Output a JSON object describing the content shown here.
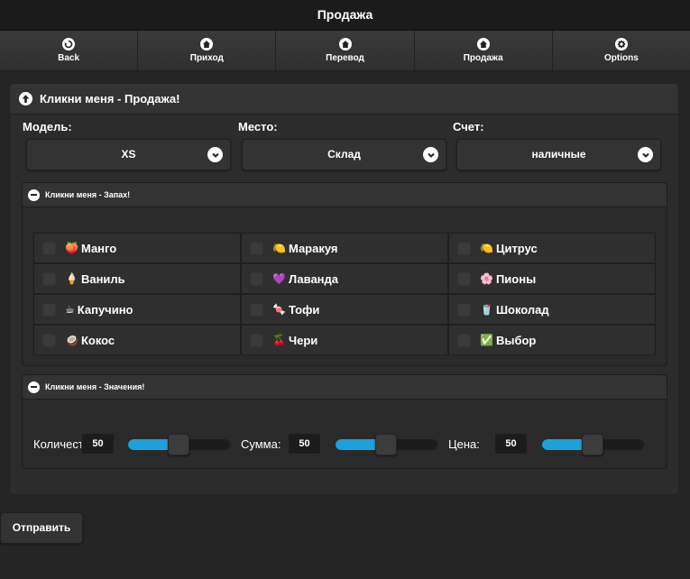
{
  "header": {
    "title": "Продажа"
  },
  "nav": [
    {
      "label": "Back",
      "icon": "back-arrow-icon"
    },
    {
      "label": "Приход",
      "icon": "home-icon"
    },
    {
      "label": "Перевод",
      "icon": "home-icon"
    },
    {
      "label": "Продажа",
      "icon": "home-icon"
    },
    {
      "label": "Options",
      "icon": "gear-icon"
    }
  ],
  "panel": {
    "title": "Кликни меня - Продажа!"
  },
  "selects": [
    {
      "label": "Модель:",
      "value": "XS"
    },
    {
      "label": "Место:",
      "value": "Склад"
    },
    {
      "label": "Счет:",
      "value": "наличные"
    }
  ],
  "scents": {
    "title": "Кликни меня - Запах!",
    "items": [
      {
        "emoji": "🍑",
        "label": "Манго"
      },
      {
        "emoji": "🍋",
        "label": "Маракуя"
      },
      {
        "emoji": "🍋",
        "label": "Цитрус"
      },
      {
        "emoji": "🍦",
        "label": "Ваниль"
      },
      {
        "emoji": "💜",
        "label": "Лаванда"
      },
      {
        "emoji": "🌸",
        "label": "Пионы"
      },
      {
        "emoji": "☕",
        "label": "Капучино"
      },
      {
        "emoji": "🍬",
        "label": "Тофи"
      },
      {
        "emoji": "🥤",
        "label": "Шоколад"
      },
      {
        "emoji": "🥥",
        "label": "Кокос"
      },
      {
        "emoji": "🍒",
        "label": "Чери"
      },
      {
        "emoji": "✅",
        "label": "Выбор"
      }
    ]
  },
  "values": {
    "title": "Кликни меня - Значения!",
    "sliders": [
      {
        "label": "Количест",
        "value": "50"
      },
      {
        "label": "Сумма:",
        "value": "50"
      },
      {
        "label": "Цена:",
        "value": "50"
      }
    ]
  },
  "submit": {
    "label": "Отправить"
  }
}
